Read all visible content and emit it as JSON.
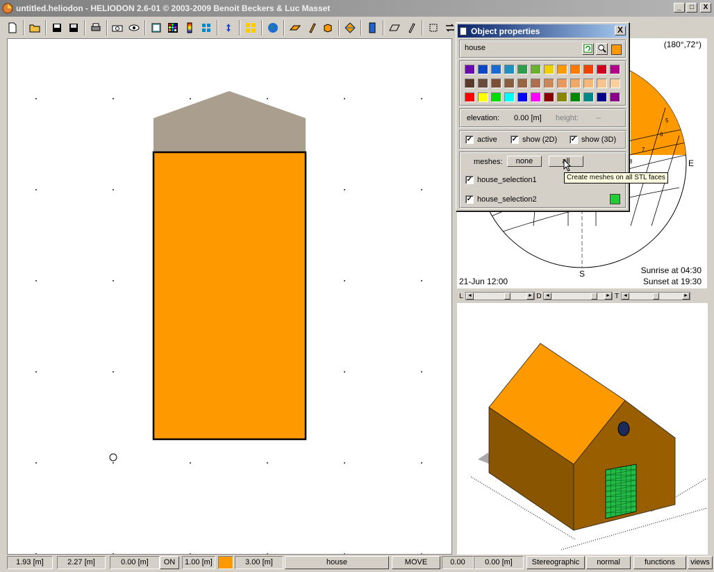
{
  "window": {
    "title": "untitled.heliodon  -  HELIODON 2.6-01 © 2003-2009 Benoit Beckers & Luc Masset",
    "minimize": "_",
    "maximize": "□",
    "close": "X"
  },
  "toolbar": {
    "icons": [
      "new-file-icon",
      "open-folder-icon",
      "save-icon",
      "save-as-icon",
      "print-icon",
      "camera-icon",
      "eye-icon",
      "view-icon",
      "grid-color-icon",
      "gradient-icon",
      "tiles-icon",
      "rotate-icon",
      "layout-icon",
      "globe-icon",
      "plane-icon",
      "pen-icon",
      "box-icon",
      "diamond-icon",
      "list-icon",
      "ruler-icon",
      "pencil-icon",
      "select-icon",
      "swap-icon"
    ]
  },
  "sun": {
    "coords": "(180°,72°)",
    "date": "21-Jun 12:00",
    "sunrise": "Sunrise at 04:30",
    "sunset": "Sunset at 19:30",
    "south": "S",
    "east": "E",
    "hours": [
      "5",
      "6",
      "7",
      "8"
    ]
  },
  "sliders": {
    "labels": [
      "L",
      "D",
      "T"
    ],
    "positions": [
      0.65,
      0.85,
      0.5
    ]
  },
  "dialog": {
    "title": "Object properties",
    "close": "X",
    "object_name": "house",
    "object_color": "#ff9900",
    "palette": [
      [
        "#6a0dad",
        "#0a47c2",
        "#1a6ad4",
        "#1f8fbf",
        "#2e9e4e",
        "#6ab02e",
        "#f0d000",
        "#ff9900",
        "#ff7a00",
        "#ee4400",
        "#cc0020",
        "#b3008a"
      ],
      [
        "#5a3a2a",
        "#6a4a3a",
        "#7a5038",
        "#8a5c40",
        "#996644",
        "#aa7050",
        "#cc8858",
        "#e69860",
        "#f0a868",
        "#f5b878",
        "#f8c490",
        "#fad0a0"
      ],
      [
        "#ff0000",
        "#ffff00",
        "#00dd00",
        "#00ffff",
        "#0000ff",
        "#ff00ff",
        "#880000",
        "#888800",
        "#008800",
        "#008888",
        "#000088",
        "#880088"
      ]
    ],
    "elevation_label": "elevation:",
    "elevation_value": "0.00 [m]",
    "height_label": "height:",
    "height_value": "--",
    "active": "active",
    "show2d": "show (2D)",
    "show3d": "show (3D)",
    "meshes_label": "meshes:",
    "none_btn": "none",
    "all_btn": "all",
    "selection1": "house_selection1",
    "selection2": "house_selection2",
    "selection2_color": "#22cc33",
    "tooltip": "Create meshes on all STL faces"
  },
  "status": {
    "x": "1.93 [m]",
    "y": "2.27 [m]",
    "z": "0.00 [m]",
    "on": "ON",
    "scale": "1.00 [m]",
    "color": "#ff9900",
    "height": "3.00 [m]",
    "object": "house",
    "mode": "MOVE",
    "val1": "0.00",
    "val2": "0.00 [m]",
    "projection": "Stereographic",
    "render": "normal",
    "functions": "functions",
    "views": "views"
  },
  "colors": {
    "house_wall": "#ff9900",
    "roof_2d": "#aa9e8e",
    "wall_dark": "#8a5500",
    "mesh_green": "#22bb44"
  }
}
